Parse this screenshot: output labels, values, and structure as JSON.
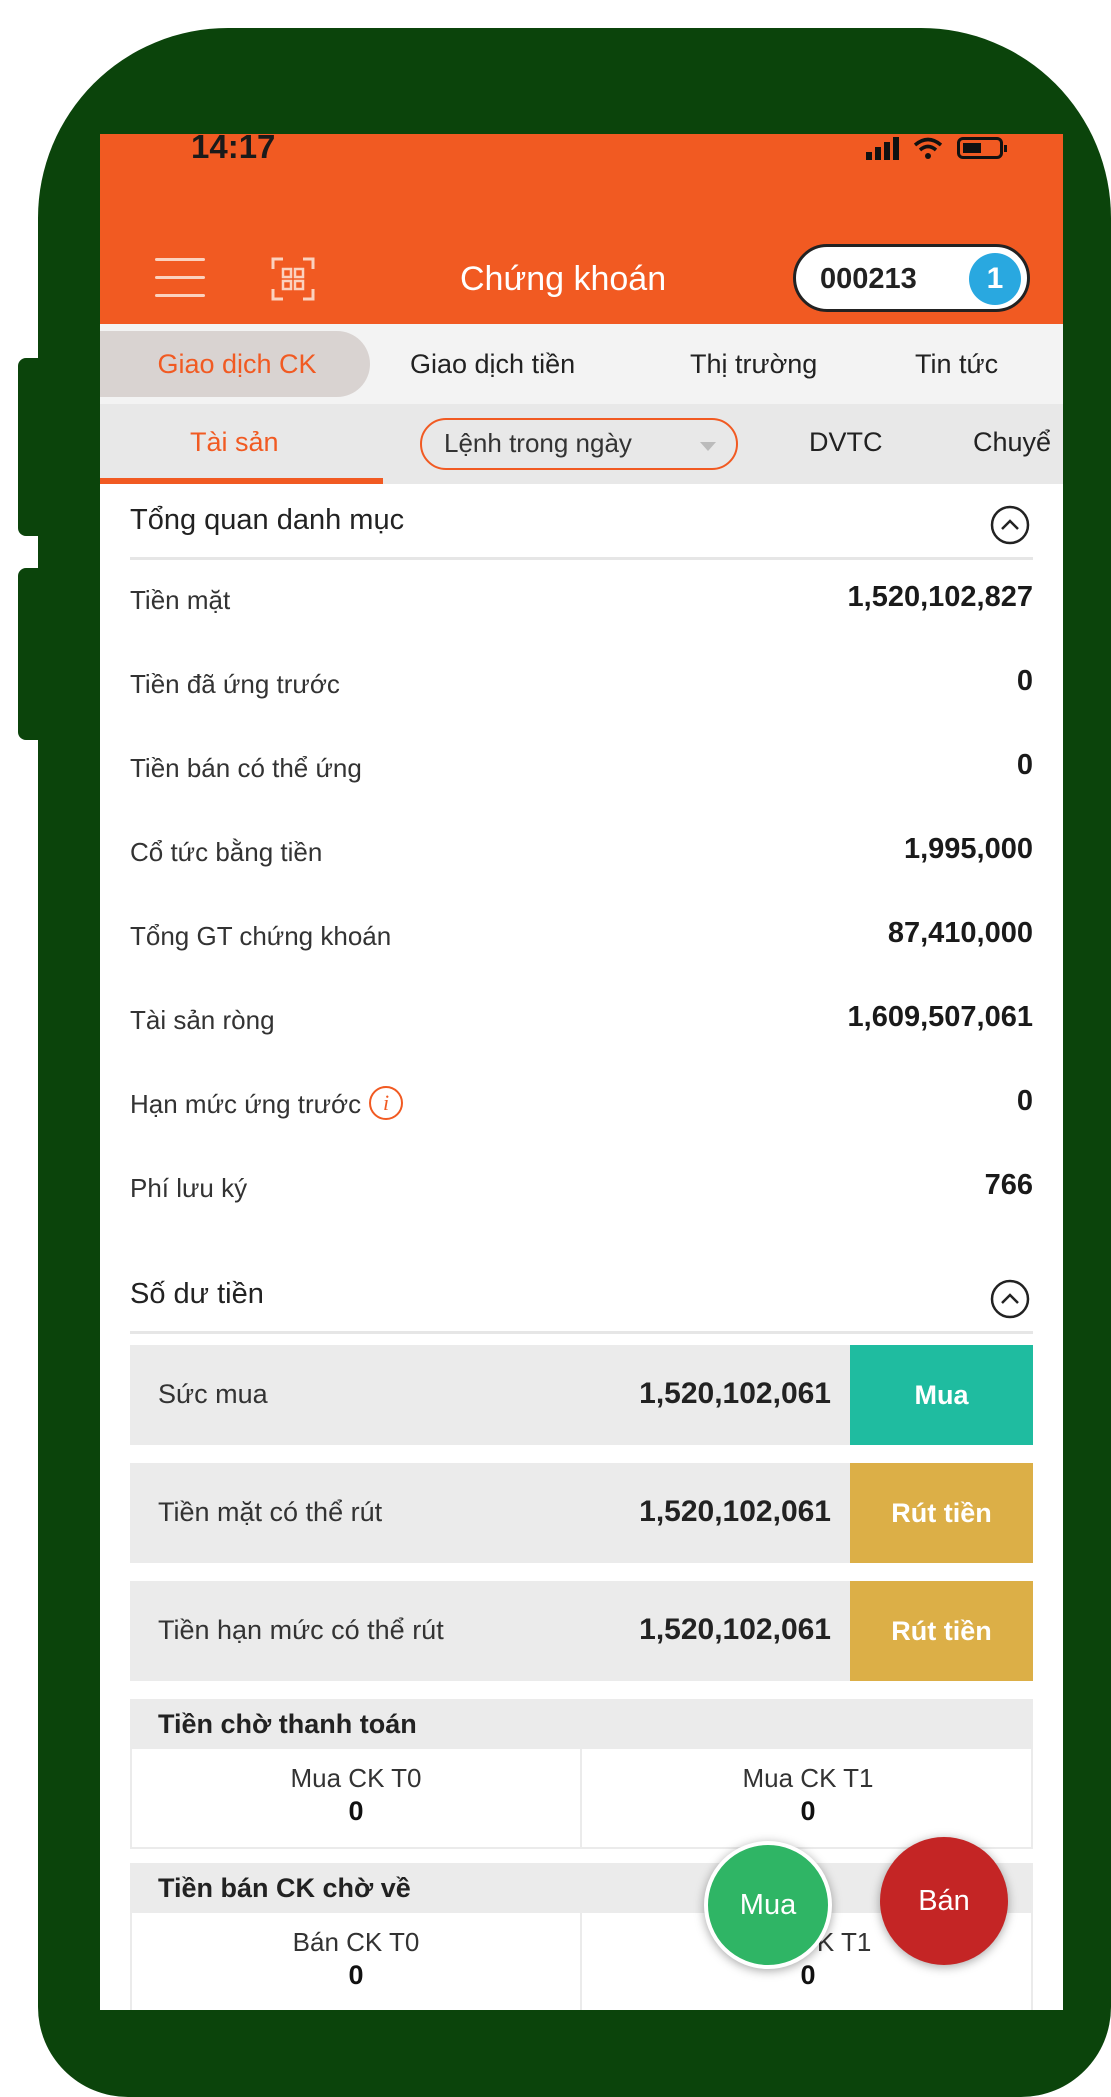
{
  "status_bar": {
    "time": "14:17"
  },
  "header": {
    "title": "Chứng khoán",
    "account_number": "000213",
    "account_badge": "1"
  },
  "main_tabs": [
    {
      "label": "Giao dịch CK",
      "active": true
    },
    {
      "label": "Giao dịch tiền",
      "active": false
    },
    {
      "label": "Thị trường",
      "active": false
    },
    {
      "label": "Tin tức",
      "active": false
    }
  ],
  "sub_tabs": [
    {
      "label": "Tài sản",
      "active": true
    },
    {
      "label": "Lệnh trong ngày",
      "active": false
    },
    {
      "label": "DVTC",
      "active": false
    },
    {
      "label": "Chuyể",
      "active": false
    }
  ],
  "portfolio": {
    "title": "Tổng quan danh mục",
    "rows": [
      {
        "label": "Tiền mặt",
        "value": "1,520,102,827"
      },
      {
        "label": "Tiền đã ứng trước",
        "value": "0"
      },
      {
        "label": "Tiền bán có thể ứng",
        "value": "0"
      },
      {
        "label": "Cổ tức bằng tiền",
        "value": "1,995,000"
      },
      {
        "label": "Tổng GT chứng khoán",
        "value": "87,410,000"
      },
      {
        "label": "Tài sản ròng",
        "value": "1,609,507,061"
      },
      {
        "label": "Hạn mức ứng trước",
        "value": "0",
        "info_icon": "i"
      },
      {
        "label": "Phí lưu ký",
        "value": "766"
      }
    ]
  },
  "cash_balance": {
    "title": "Số dư tiền",
    "rows": [
      {
        "label": "Sức mua",
        "value": "1,520,102,061",
        "button": "Mua"
      },
      {
        "label": "Tiền mặt có thể rút",
        "value": "1,520,102,061",
        "button": "Rút tiền"
      },
      {
        "label": "Tiền hạn mức có thể rút",
        "value": "1,520,102,061",
        "button": "Rút tiền"
      }
    ]
  },
  "pending_payment": {
    "title": "Tiền chờ thanh toán",
    "cells": [
      {
        "label": "Mua CK T0",
        "value": "0"
      },
      {
        "label": "Mua CK T1",
        "value": "0"
      }
    ]
  },
  "pending_sale": {
    "title": "Tiền bán CK chờ về",
    "cells": [
      {
        "label": "Bán CK T0",
        "value": "0"
      },
      {
        "label": "Bán CK T1",
        "value": "0"
      }
    ]
  },
  "fab": {
    "buy": "Mua",
    "sell": "Bán"
  },
  "colors": {
    "brand_orange": "#f15a22",
    "frame_green": "#0b440b",
    "buy_teal": "#1fbca0",
    "withdraw_gold": "#dcaf47",
    "fab_buy_green": "#2fb565",
    "fab_sell_red": "#c42525",
    "badge_blue": "#29a8e0"
  }
}
